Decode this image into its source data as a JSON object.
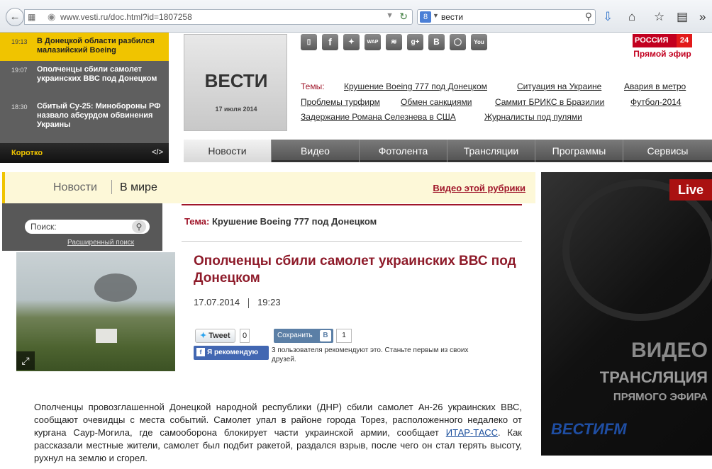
{
  "browser": {
    "url": "www.vesti.ru/doc.html?id=1807258",
    "search_query": "вести"
  },
  "ticker": {
    "items": [
      {
        "time": "19:13",
        "text": "В Донецкой области разбился малазийский Boeing"
      },
      {
        "time": "19:07",
        "text": "Ополченцы сбили самолет украинских ВВС под Донецком"
      },
      {
        "time": "18:30",
        "text": "Сбитый Су-25: Минобороны РФ назвало абсурдом обвинения Украины"
      }
    ],
    "footer_label": "Коротко",
    "footer_code": "</>"
  },
  "logo": {
    "text": "ВЕСТИ",
    "date": "17 июля 2014"
  },
  "social": [
    "mobile-icon",
    "facebook-icon",
    "twitter-icon",
    "wap-icon",
    "rss-icon",
    "googleplus-icon",
    "vk-icon",
    "instagram-icon",
    "youtube-icon"
  ],
  "social_labels": {
    "wap": "WAP",
    "gplus": "g+",
    "vk": "B",
    "youtube": "You"
  },
  "russia24": {
    "name": "РОССИЯ",
    "num": "24",
    "live": "Прямой эфир"
  },
  "topics": {
    "label": "Темы:",
    "items": [
      "Крушение Boeing 777 под Донецком",
      "Ситуация на Украине",
      "Авария в метро",
      "Проблемы турфирм",
      "Обмен санкциями",
      "Саммит БРИКС в Бразилии",
      "Футбол-2014",
      "Задержание Романа Селезнева в США",
      "Журналисты под пулями"
    ]
  },
  "nav": {
    "tabs": [
      "Новости",
      "Видео",
      "Фотолента",
      "Трансляции",
      "Программы",
      "Сервисы"
    ]
  },
  "breadcrumb": {
    "section": "Новости",
    "subsection": "В мире",
    "video_link": "Видео этой рубрики"
  },
  "site_search": {
    "placeholder": "Поиск:",
    "advanced": "Расширенный поиск"
  },
  "theme": {
    "label": "Тема:",
    "value": "Крушение Boeing 777 под Донецком"
  },
  "article": {
    "title": "Ополченцы сбили самолет украинских ВВС под Донецком",
    "date": "17.07.2014",
    "time": "19:23",
    "tweet_label": "Tweet",
    "tweet_count": "0",
    "vk_label": "Сохранить",
    "vk_letter": "В",
    "vk_count": "1",
    "fb_label": "Я рекомендую",
    "fb_text": "3 пользователя рекомендуют это. Станьте первым из своих друзей.",
    "body_part1": "Ополченцы провозглашенной Донецкой народной республики (ДНР) сбили самолет Ан-26 украинских ВВС, сообщают очевидцы с места событий. Самолет упал в районе города Торез, расположенного недалеко от кургана Саур-Могила, где самооборона блокирует части украинской армии, сообщает ",
    "body_link": "ИТАР-ТАСС",
    "body_part2": ". Как рассказали местные жители, самолет был подбит ракетой, раздался взрыв, после чего он стал терять высоту, рухнул на землю и сгорел."
  },
  "promo": {
    "live_tag": "Live",
    "line1": "ВИДЕО",
    "line2": "ТРАНСЛЯЦИЯ",
    "line3": "ПРЯМОГО ЭФИРА",
    "brand": "ВЕСТИFM"
  },
  "colors": {
    "accent": "#a0162a",
    "ticker_active": "#f0c400"
  }
}
